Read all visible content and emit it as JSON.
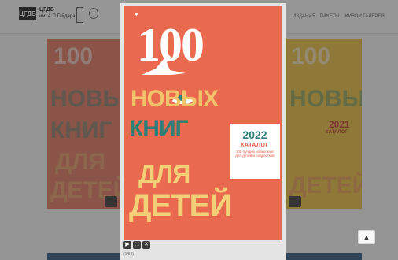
{
  "header": {
    "logo_mark": "ЦГДБ",
    "logo_title": "ЦГДБ",
    "logo_subtitle": "им. А.П.Гайдара",
    "nav": [
      "ИЗДАНИЯ",
      "ПАКЕТЫ",
      "ЖИВОЙ ГАЛЕРЕЯ"
    ]
  },
  "background": {
    "left_book": {
      "color": "#e67a63"
    },
    "right_book": {
      "color": "#f1c544",
      "year": "2021",
      "label": "КАТАЛОГ"
    }
  },
  "lightbox": {
    "cover": {
      "number": "100",
      "words": [
        "НОВЫХ",
        "КНИГ",
        "ДЛЯ",
        "ДЕТЕЙ"
      ],
      "catalog_year": "2022",
      "catalog_title": "КАТАЛОГ",
      "catalog_desc": "100 лучших новых книг для детей и подростков",
      "colors": {
        "background": "#ea6a4f",
        "teal": "#2f7f78",
        "yellow": "#f3d077"
      }
    },
    "controls": [
      "play-icon",
      "fullscreen-icon",
      "close-icon"
    ],
    "counter": "(1/52)"
  },
  "scroll_top_icon": "chevron-up-icon"
}
